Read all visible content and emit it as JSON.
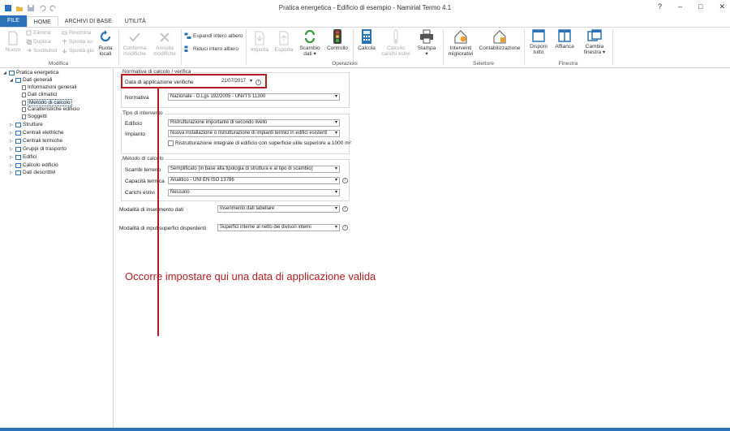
{
  "window": {
    "title": "Pratica energetica - Edificio di esempio - Namirial Termo 4.1",
    "help": "?",
    "minimize": "–",
    "maximize": "□",
    "close": "✕"
  },
  "tabs": [
    "FILE",
    "HOME",
    "ARCHIVI DI BASE",
    "UTILITÀ"
  ],
  "ribbon": {
    "modifica": {
      "label": "Modifica",
      "nuovo": "Nuovo",
      "elimina": "Elimina",
      "duplica": "Duplica",
      "sostituisci": "Sostituisci",
      "rinomina": "Rinomina",
      "sposta_su": "Sposta su",
      "sposta_giu": "Sposta giù",
      "ruota_locali": [
        "Ruota",
        "locali"
      ],
      "conferma": [
        "Conferma",
        "modifiche"
      ],
      "annulla": [
        "Annulla",
        "modifiche"
      ]
    },
    "albero": {
      "espandi": "Espandi intero albero",
      "riduci": "Riduci intero albero"
    },
    "operazioni": {
      "label": "Operazioni",
      "importa": "Importa",
      "esporta": "Esporta",
      "scambio": [
        "Scambio",
        "dati ▾"
      ],
      "controllo": "Controllo",
      "calcola": "Calcola",
      "calcolo_carichi": [
        "Calcolo",
        "carichi estivi"
      ],
      "stampa": [
        "Stampa",
        "▾"
      ]
    },
    "selettore": {
      "label": "Selettore",
      "interventi": [
        "Interventi",
        "migliorativi"
      ],
      "contabilizzazione": "Contabilizzazione"
    },
    "finestra": {
      "label": "Finestra",
      "disponi": [
        "Disponi",
        "tutto"
      ],
      "affianca": "Affianca",
      "cambia": [
        "Cambia",
        "finestra ▾"
      ]
    }
  },
  "tree": [
    {
      "label": "Pratica energetica",
      "level": 0,
      "expander": "◢",
      "icon": "folder"
    },
    {
      "label": "Dati generali",
      "level": 1,
      "expander": "◢",
      "icon": "folder"
    },
    {
      "label": "Informazioni generali",
      "level": 2,
      "icon": "page"
    },
    {
      "label": "Dati climatici",
      "level": 2,
      "icon": "page"
    },
    {
      "label": "Metodo di calcolo",
      "level": 2,
      "icon": "page",
      "selected": true
    },
    {
      "label": "Caratteristiche edificio",
      "level": 2,
      "icon": "page"
    },
    {
      "label": "Soggetti",
      "level": 2,
      "icon": "page"
    },
    {
      "label": "Strutture",
      "level": 1,
      "expander": "▷",
      "icon": "folder"
    },
    {
      "label": "Centrali elettriche",
      "level": 1,
      "expander": "▷",
      "icon": "folder"
    },
    {
      "label": "Centrali termiche",
      "level": 1,
      "expander": "▷",
      "icon": "folder"
    },
    {
      "label": "Gruppi di trasporto",
      "level": 1,
      "expander": "▷",
      "icon": "folder"
    },
    {
      "label": "Edifici",
      "level": 1,
      "expander": "▷",
      "icon": "folder"
    },
    {
      "label": "Calcolo edificio",
      "level": 1,
      "expander": "▷",
      "icon": "folder"
    },
    {
      "label": "Dati descrittivi",
      "level": 1,
      "expander": "▷",
      "icon": "folder"
    }
  ],
  "form": {
    "normativa_group": "Normativa di calcolo / verifica",
    "data_label": "Data di applicazione verifiche",
    "data_value": "21/07/2017",
    "normativa_label": "Normativa",
    "normativa_value": "Nazionale - D.Lgs 192/2005 - UNI/TS 11300",
    "intervento_group": "Tipo di intervento",
    "edificio_label": "Edificio",
    "edificio_value": "Ristrutturazione importante di secondo livello",
    "impianto_label": "Impianto",
    "impianto_value": "Nuova installazione o ristrutturazione di impianti termici in edifici esistenti",
    "ristrutt_label": "Ristrutturazione integrale di edificio con superficie utile superiore a 1000 m²",
    "metodo_group": "Metodo di calcolo",
    "scambi_label": "Scambi terreno",
    "scambi_value": "Semplificato (in base alla tipologia di struttura e al tipo di scambio)",
    "capacita_label": "Capacità termica",
    "capacita_value": "Analitico - UNI EN ISO 13786",
    "carichi_label": "Carichi estivi",
    "carichi_value": "Nessuno",
    "modalita_label": "Modalità di inserimento dati",
    "modalita_value": "Inserimento dati tabellare",
    "input_label": "Modalità di input superfici disperdenti",
    "input_value": "Superfici interne al netto dei divisori interni",
    "info_glyph": "i",
    "arrow_glyph": "▾"
  },
  "annotation": {
    "text": "Occorre impostare qui una data di applicazione valida",
    "color": "#b01c20"
  },
  "colors": {
    "accent": "#2b73b8",
    "annotation": "#b01c20"
  }
}
